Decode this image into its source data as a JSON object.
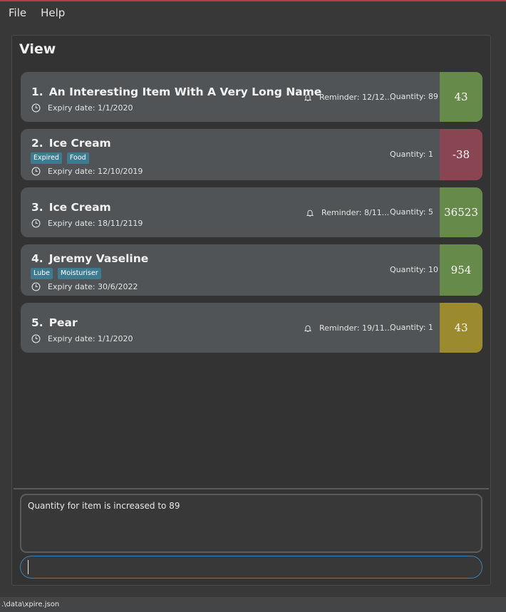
{
  "menu": {
    "file": "File",
    "help": "Help"
  },
  "panel": {
    "title": "View"
  },
  "items": [
    {
      "index": "1.",
      "name": "An Interesting Item With A Very Long Name",
      "tags": [],
      "expiry": "Expiry date: 1/1/2020",
      "reminder": "Reminder: 12/12...",
      "quantity": "Quantity: 89",
      "days": "43",
      "days_color": "#668a49"
    },
    {
      "index": "2.",
      "name": "Ice Cream",
      "tags": [
        "Expired",
        "Food"
      ],
      "expiry": "Expiry date: 12/10/2019",
      "reminder": "",
      "quantity": "Quantity: 1",
      "days": "-38",
      "days_color": "#8a4552"
    },
    {
      "index": "3.",
      "name": "Ice Cream",
      "tags": [],
      "expiry": "Expiry date: 18/11/2119",
      "reminder": "Reminder: 8/11...",
      "quantity": "Quantity: 5",
      "days": "36523",
      "days_color": "#668a49"
    },
    {
      "index": "4.",
      "name": "Jeremy Vaseline",
      "tags": [
        "Lube",
        "Moisturiser"
      ],
      "expiry": "Expiry date: 30/6/2022",
      "reminder": "",
      "quantity": "Quantity: 10",
      "days": "954",
      "days_color": "#668a49"
    },
    {
      "index": "5.",
      "name": "Pear",
      "tags": [],
      "expiry": "Expiry date: 1/1/2020",
      "reminder": "Reminder: 19/11...",
      "quantity": "Quantity: 1",
      "days": "43",
      "days_color": "#9c8a2e"
    }
  ],
  "result": {
    "message": "Quantity for item is increased to 89"
  },
  "command": {
    "value": "",
    "placeholder": ""
  },
  "status": {
    "path": ".\\data\\xpire.json"
  },
  "colors": {
    "accent": "#3e7fb0",
    "tag": "#3e7b91",
    "top_line": "#b83a4e"
  }
}
